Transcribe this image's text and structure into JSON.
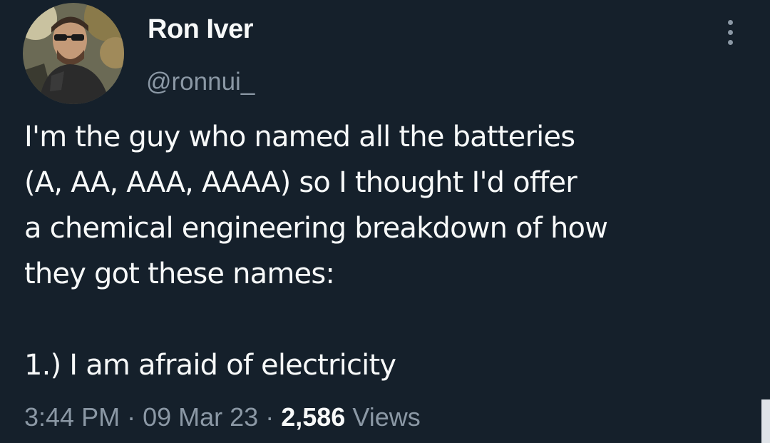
{
  "tweet": {
    "author": {
      "display_name": "Ron Iver",
      "handle": "@ronnui_"
    },
    "more_icon": "more-vertical-icon",
    "text_lines": [
      "I'm the guy who named all the batteries",
      "(A, AA, AAA, AAAA) so I thought I'd offer",
      "a chemical engineering breakdown of how",
      "they got these names:"
    ],
    "final_line": "1.) I am afraid of electricity",
    "meta": {
      "time": "3:44 PM",
      "separator": "·",
      "date": "09 Mar 23",
      "views_count": "2,586",
      "views_label": "Views"
    }
  },
  "colors": {
    "background": "#15202b",
    "primary_text": "#f7f9f9",
    "secondary_text": "#8b98a5"
  }
}
